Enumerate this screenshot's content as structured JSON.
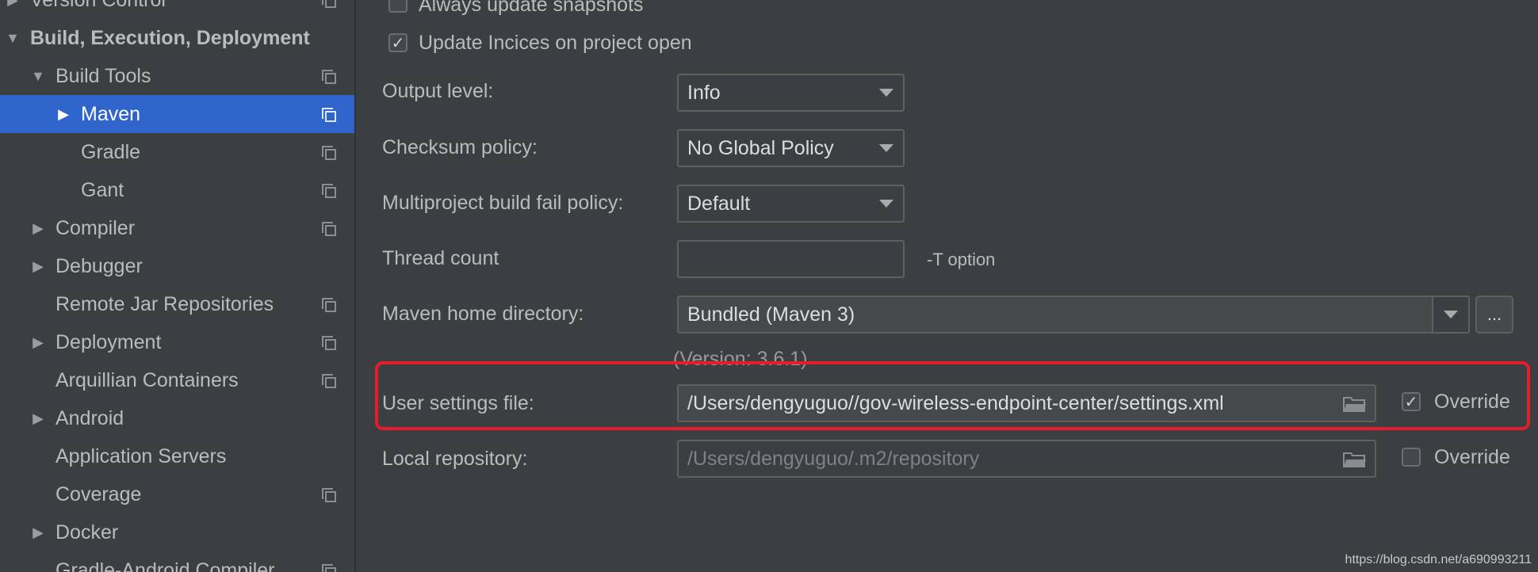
{
  "sidebar": {
    "items": [
      {
        "label": "Version Control",
        "arrow": "▶",
        "icon": true
      },
      {
        "label": "Build, Execution, Deployment",
        "arrow": "▼",
        "icon": false
      },
      {
        "label": "Build Tools",
        "arrow": "▼",
        "icon": true
      },
      {
        "label": "Maven",
        "arrow": "▶",
        "icon": true
      },
      {
        "label": "Gradle",
        "arrow": "",
        "icon": true
      },
      {
        "label": "Gant",
        "arrow": "",
        "icon": true
      },
      {
        "label": "Compiler",
        "arrow": "▶",
        "icon": true
      },
      {
        "label": "Debugger",
        "arrow": "▶",
        "icon": false
      },
      {
        "label": "Remote Jar Repositories",
        "arrow": "",
        "icon": true
      },
      {
        "label": "Deployment",
        "arrow": "▶",
        "icon": true
      },
      {
        "label": "Arquillian Containers",
        "arrow": "",
        "icon": true
      },
      {
        "label": "Android",
        "arrow": "▶",
        "icon": false
      },
      {
        "label": "Application Servers",
        "arrow": "",
        "icon": false
      },
      {
        "label": "Coverage",
        "arrow": "",
        "icon": true
      },
      {
        "label": "Docker",
        "arrow": "▶",
        "icon": false
      },
      {
        "label": "Gradle-Android Compiler",
        "arrow": "",
        "icon": true
      }
    ],
    "selected_index": 3
  },
  "maven": {
    "always_update_snapshots": {
      "label": "Always update snapshots",
      "checked": false
    },
    "update_indices": {
      "label": "Update Incices on project open",
      "checked": true,
      "mark": "✓"
    },
    "output_level": {
      "label": "Output level:",
      "value": "Info"
    },
    "checksum_policy": {
      "label": "Checksum policy:",
      "value": "No Global Policy"
    },
    "multiproject_fail_policy": {
      "label": "Multiproject build fail policy:",
      "value": "Default"
    },
    "thread_count": {
      "label": "Thread count",
      "value": "",
      "hint": "-T option"
    },
    "maven_home": {
      "label": "Maven home directory:",
      "value": "Bundled (Maven 3)",
      "browse_label": "...",
      "version": "(Version: 3.6.1)"
    },
    "user_settings": {
      "label": "User settings file:",
      "value": "/Users/dengyuguo//gov-wireless-endpoint-center/settings.xml",
      "override_label": "Override",
      "override_checked": true,
      "mark": "✓"
    },
    "local_repo": {
      "label": "Local repository:",
      "value": "/Users/dengyuguo/.m2/repository",
      "override_label": "Override",
      "override_checked": false
    }
  },
  "watermark": "https://blog.csdn.net/a690993211",
  "colors": {
    "selection": "#2f65ca",
    "highlight": "#e31d2b",
    "background": "#3c3f41"
  }
}
